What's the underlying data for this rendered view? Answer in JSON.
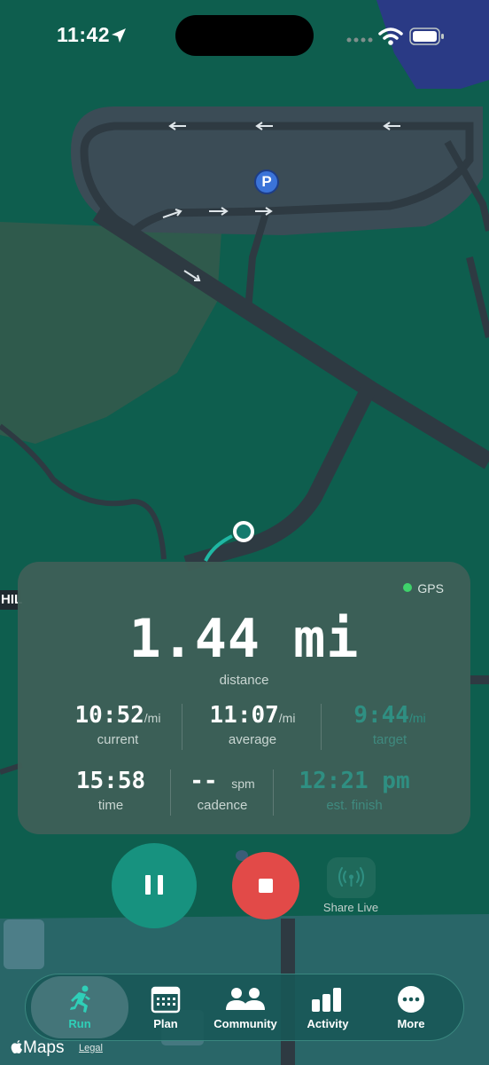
{
  "status_bar": {
    "time": "11:42",
    "icons": [
      "location-arrow-icon",
      "cellular-signal-icon",
      "wifi-icon",
      "battery-icon"
    ]
  },
  "map": {
    "parking_marker": "P",
    "edge_label": "HIL",
    "attribution": {
      "brand": "Maps",
      "legal": "Legal"
    },
    "colors": {
      "land": "#0e5e4e",
      "park": "#2f5a4c",
      "water": "#2a3a85",
      "road": "#2e3a42",
      "lot": "#3b4c56"
    }
  },
  "stats": {
    "gps_label": "GPS",
    "distance_value": "1.44 mi",
    "distance_label": "distance",
    "current": {
      "value": "10:52",
      "unit": "/mi",
      "label": "current"
    },
    "average": {
      "value": "11:07",
      "unit": "/mi",
      "label": "average"
    },
    "target": {
      "value": "9:44",
      "unit": "/mi",
      "label": "target"
    },
    "time": {
      "value": "15:58",
      "label": "time"
    },
    "cadence": {
      "value": "--",
      "unit": "spm",
      "label": "cadence"
    },
    "finish": {
      "value": "12:21 pm",
      "label": "est. finish"
    }
  },
  "controls": {
    "pause_icon": "pause-icon",
    "stop_icon": "stop-icon",
    "share_label": "Share Live"
  },
  "tabs": [
    {
      "label": "Run",
      "icon": "runner-icon",
      "active": true
    },
    {
      "label": "Plan",
      "icon": "calendar-icon",
      "active": false
    },
    {
      "label": "Community",
      "icon": "people-icon",
      "active": false
    },
    {
      "label": "Activity",
      "icon": "bar-chart-icon",
      "active": false
    },
    {
      "label": "More",
      "icon": "ellipsis-icon",
      "active": false
    }
  ],
  "accent_colors": {
    "teal": "#17927f",
    "stop_red": "#e24a48",
    "gps_green": "#3fd26b",
    "active_tab": "#2fcfb8"
  }
}
